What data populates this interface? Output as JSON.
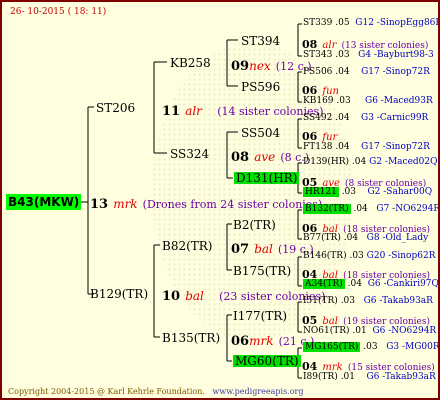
{
  "header": "26- 10-2015 ( 18: 11)",
  "footer": {
    "copyright": "Copyright 2004-2015 @ Karl Kehrle Foundation.",
    "url": "www.pedigreeapis.org"
  },
  "root": {
    "code": "B43(MKW)",
    "number": "13",
    "race": "mrk",
    "description": "(Drones from 24 sister colonies)"
  },
  "gen1": [
    {
      "code": "ST206",
      "number": "11",
      "race": "alr",
      "sisters": "(14 sister colonies)"
    },
    {
      "code": "B129(TR)",
      "number": "10",
      "race": "bal",
      "sisters": "(23 sister colonies)"
    }
  ],
  "gen2": [
    {
      "code": "KB258",
      "number": "09",
      "race": "nex",
      "sisters": "(12 c.)"
    },
    {
      "code": "SS324",
      "number": "08",
      "race": "ave",
      "sisters": "(8 c.)"
    },
    {
      "code": "B82(TR)",
      "number": "07",
      "race": "bal",
      "sisters": "(19 c.)"
    },
    {
      "code": "B135(TR)",
      "number": "06",
      "race": "mrk",
      "sisters": "(21 c.)"
    }
  ],
  "gen3": [
    {
      "code": "ST394",
      "number": "08",
      "race": "alr",
      "sisters": "(13 sister colonies)"
    },
    {
      "code": "PS596",
      "number": "06",
      "race": "fun",
      "sisters": ""
    },
    {
      "code": "SS504",
      "number": "06",
      "race": "fur",
      "sisters": ""
    },
    {
      "code": "D131(HR)",
      "number": "05",
      "race": "ave",
      "sisters": "(8 sister colonies)"
    },
    {
      "code": "B2(TR)",
      "number": "06",
      "race": "bal",
      "sisters": "(18 sister colonies)"
    },
    {
      "code": "B175(TR)",
      "number": "04",
      "race": "bal",
      "sisters": "(18 sister colonies)"
    },
    {
      "code": "I177(TR)",
      "number": "05",
      "race": "bal",
      "sisters": "(19 sister colonies)"
    },
    {
      "code": "MG60(TR)",
      "number": "04",
      "race": "mrk",
      "sisters": "(15 sister colonies)"
    }
  ],
  "gen4": [
    {
      "code": "ST339",
      "year": ".05",
      "location": "G12 -SinopEgg86R"
    },
    {
      "code": "ST343",
      "year": ".03",
      "location": "G4 -Bayburt98-3"
    },
    {
      "code": "PS506",
      "year": ".04",
      "location": "G17 -Sinop72R"
    },
    {
      "code": "KB169",
      "year": ".03",
      "location": "G6 -Maced93R"
    },
    {
      "code": "SS492",
      "year": ".04",
      "location": "G3 -Carnic99R"
    },
    {
      "code": "FT138",
      "year": ".04",
      "location": "G17 -Sinop72R"
    },
    {
      "code": "D139(HR)",
      "year": ".04",
      "location": "G2 -Maced02Q"
    },
    {
      "code": "HR121",
      "year": ".03",
      "location": "G2 -Sahar00Q"
    },
    {
      "code": "B132(TR)",
      "year": ".04",
      "location": "G7 -NO6294R"
    },
    {
      "code": "B77(TR)",
      "year": ".04",
      "location": "G8 -Old_Lady"
    },
    {
      "code": "B146(TR)",
      "year": ".03",
      "location": "G20 -Sinop62R"
    },
    {
      "code": "A34(TR)",
      "year": ".04",
      "location": "G6 -Cankiri97Q"
    },
    {
      "code": "I51(TR)",
      "year": ".03",
      "location": "G6 -Takab93aR"
    },
    {
      "code": "NO61(TR)",
      "year": ".01",
      "location": "G6 -NO6294R"
    },
    {
      "code": "MG165(TR)",
      "year": ".03",
      "location": "G3 -MG00R"
    },
    {
      "code": "I89(TR)",
      "year": ".01",
      "location": "G6 -Takab93aR"
    }
  ],
  "colors": {
    "border": "#800000",
    "background": "#ffffe0",
    "highlight": "#00ff00",
    "race": "#e00000",
    "sisters": "#6a00a8",
    "location": "#0000c0"
  }
}
